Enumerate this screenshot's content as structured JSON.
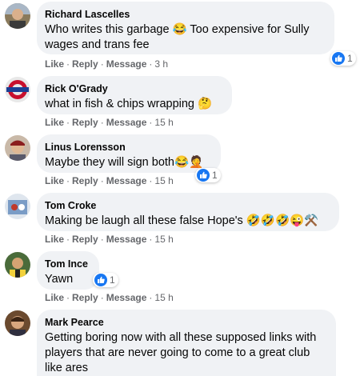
{
  "comments": [
    {
      "author": "Richard Lascelles",
      "text": "Who writes this garbage 😂 Too expensive for Sully wages and trans fee",
      "actions": {
        "like": "Like",
        "reply": "Reply",
        "message": "Message",
        "time": "3 h"
      },
      "reaction_count": "1"
    },
    {
      "author": "Rick O'Grady",
      "text": "what in fish & chips wrapping 🤔",
      "actions": {
        "like": "Like",
        "reply": "Reply",
        "message": "Message",
        "time": "15 h"
      }
    },
    {
      "author": "Linus Lorensson",
      "text": "Maybe they will sign both😂🤦",
      "actions": {
        "like": "Like",
        "reply": "Reply",
        "message": "Message",
        "time": "15 h"
      },
      "reaction_count": "1"
    },
    {
      "author": "Tom Croke",
      "text": "Making be laugh all these false Hope's 🤣🤣🤣😜⚒️",
      "actions": {
        "like": "Like",
        "reply": "Reply",
        "message": "Message",
        "time": "15 h"
      }
    },
    {
      "author": "Tom Ince",
      "text": "Yawn",
      "actions": {
        "like": "Like",
        "reply": "Reply",
        "message": "Message",
        "time": "15 h"
      },
      "reaction_count": "1"
    },
    {
      "author": "Mark Pearce",
      "text": "Getting boring now with all these supposed links with players that are never going to come to a great club like ares"
    }
  ],
  "colors": {
    "bubble": "#f0f2f5",
    "meta_text": "#65676b",
    "like_blue": "#1877f2"
  },
  "icons": [
    "like-thumb-icon"
  ]
}
